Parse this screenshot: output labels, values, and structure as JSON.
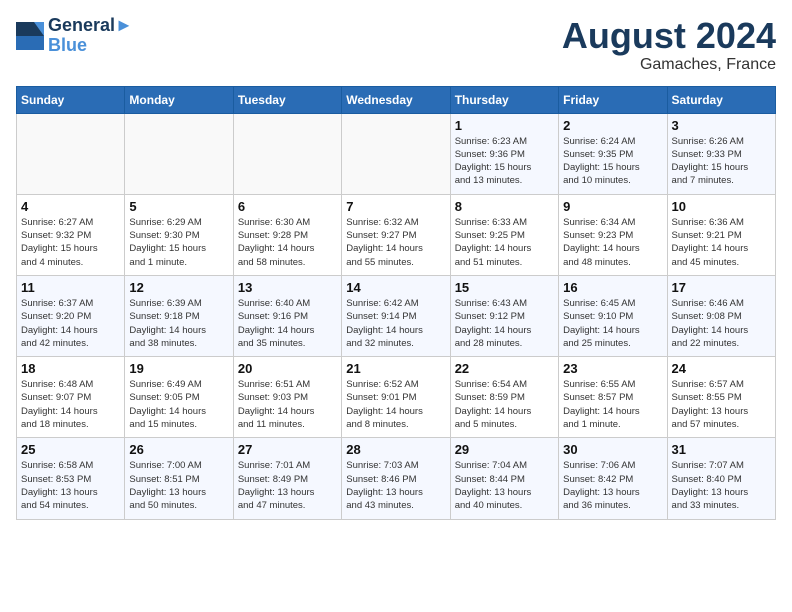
{
  "header": {
    "logo_line1": "General",
    "logo_line2": "Blue",
    "month_year": "August 2024",
    "location": "Gamaches, France"
  },
  "days_of_week": [
    "Sunday",
    "Monday",
    "Tuesday",
    "Wednesday",
    "Thursday",
    "Friday",
    "Saturday"
  ],
  "weeks": [
    [
      {
        "day": "",
        "info": ""
      },
      {
        "day": "",
        "info": ""
      },
      {
        "day": "",
        "info": ""
      },
      {
        "day": "",
        "info": ""
      },
      {
        "day": "1",
        "info": "Sunrise: 6:23 AM\nSunset: 9:36 PM\nDaylight: 15 hours\nand 13 minutes."
      },
      {
        "day": "2",
        "info": "Sunrise: 6:24 AM\nSunset: 9:35 PM\nDaylight: 15 hours\nand 10 minutes."
      },
      {
        "day": "3",
        "info": "Sunrise: 6:26 AM\nSunset: 9:33 PM\nDaylight: 15 hours\nand 7 minutes."
      }
    ],
    [
      {
        "day": "4",
        "info": "Sunrise: 6:27 AM\nSunset: 9:32 PM\nDaylight: 15 hours\nand 4 minutes."
      },
      {
        "day": "5",
        "info": "Sunrise: 6:29 AM\nSunset: 9:30 PM\nDaylight: 15 hours\nand 1 minute."
      },
      {
        "day": "6",
        "info": "Sunrise: 6:30 AM\nSunset: 9:28 PM\nDaylight: 14 hours\nand 58 minutes."
      },
      {
        "day": "7",
        "info": "Sunrise: 6:32 AM\nSunset: 9:27 PM\nDaylight: 14 hours\nand 55 minutes."
      },
      {
        "day": "8",
        "info": "Sunrise: 6:33 AM\nSunset: 9:25 PM\nDaylight: 14 hours\nand 51 minutes."
      },
      {
        "day": "9",
        "info": "Sunrise: 6:34 AM\nSunset: 9:23 PM\nDaylight: 14 hours\nand 48 minutes."
      },
      {
        "day": "10",
        "info": "Sunrise: 6:36 AM\nSunset: 9:21 PM\nDaylight: 14 hours\nand 45 minutes."
      }
    ],
    [
      {
        "day": "11",
        "info": "Sunrise: 6:37 AM\nSunset: 9:20 PM\nDaylight: 14 hours\nand 42 minutes."
      },
      {
        "day": "12",
        "info": "Sunrise: 6:39 AM\nSunset: 9:18 PM\nDaylight: 14 hours\nand 38 minutes."
      },
      {
        "day": "13",
        "info": "Sunrise: 6:40 AM\nSunset: 9:16 PM\nDaylight: 14 hours\nand 35 minutes."
      },
      {
        "day": "14",
        "info": "Sunrise: 6:42 AM\nSunset: 9:14 PM\nDaylight: 14 hours\nand 32 minutes."
      },
      {
        "day": "15",
        "info": "Sunrise: 6:43 AM\nSunset: 9:12 PM\nDaylight: 14 hours\nand 28 minutes."
      },
      {
        "day": "16",
        "info": "Sunrise: 6:45 AM\nSunset: 9:10 PM\nDaylight: 14 hours\nand 25 minutes."
      },
      {
        "day": "17",
        "info": "Sunrise: 6:46 AM\nSunset: 9:08 PM\nDaylight: 14 hours\nand 22 minutes."
      }
    ],
    [
      {
        "day": "18",
        "info": "Sunrise: 6:48 AM\nSunset: 9:07 PM\nDaylight: 14 hours\nand 18 minutes."
      },
      {
        "day": "19",
        "info": "Sunrise: 6:49 AM\nSunset: 9:05 PM\nDaylight: 14 hours\nand 15 minutes."
      },
      {
        "day": "20",
        "info": "Sunrise: 6:51 AM\nSunset: 9:03 PM\nDaylight: 14 hours\nand 11 minutes."
      },
      {
        "day": "21",
        "info": "Sunrise: 6:52 AM\nSunset: 9:01 PM\nDaylight: 14 hours\nand 8 minutes."
      },
      {
        "day": "22",
        "info": "Sunrise: 6:54 AM\nSunset: 8:59 PM\nDaylight: 14 hours\nand 5 minutes."
      },
      {
        "day": "23",
        "info": "Sunrise: 6:55 AM\nSunset: 8:57 PM\nDaylight: 14 hours\nand 1 minute."
      },
      {
        "day": "24",
        "info": "Sunrise: 6:57 AM\nSunset: 8:55 PM\nDaylight: 13 hours\nand 57 minutes."
      }
    ],
    [
      {
        "day": "25",
        "info": "Sunrise: 6:58 AM\nSunset: 8:53 PM\nDaylight: 13 hours\nand 54 minutes."
      },
      {
        "day": "26",
        "info": "Sunrise: 7:00 AM\nSunset: 8:51 PM\nDaylight: 13 hours\nand 50 minutes."
      },
      {
        "day": "27",
        "info": "Sunrise: 7:01 AM\nSunset: 8:49 PM\nDaylight: 13 hours\nand 47 minutes."
      },
      {
        "day": "28",
        "info": "Sunrise: 7:03 AM\nSunset: 8:46 PM\nDaylight: 13 hours\nand 43 minutes."
      },
      {
        "day": "29",
        "info": "Sunrise: 7:04 AM\nSunset: 8:44 PM\nDaylight: 13 hours\nand 40 minutes."
      },
      {
        "day": "30",
        "info": "Sunrise: 7:06 AM\nSunset: 8:42 PM\nDaylight: 13 hours\nand 36 minutes."
      },
      {
        "day": "31",
        "info": "Sunrise: 7:07 AM\nSunset: 8:40 PM\nDaylight: 13 hours\nand 33 minutes."
      }
    ]
  ]
}
